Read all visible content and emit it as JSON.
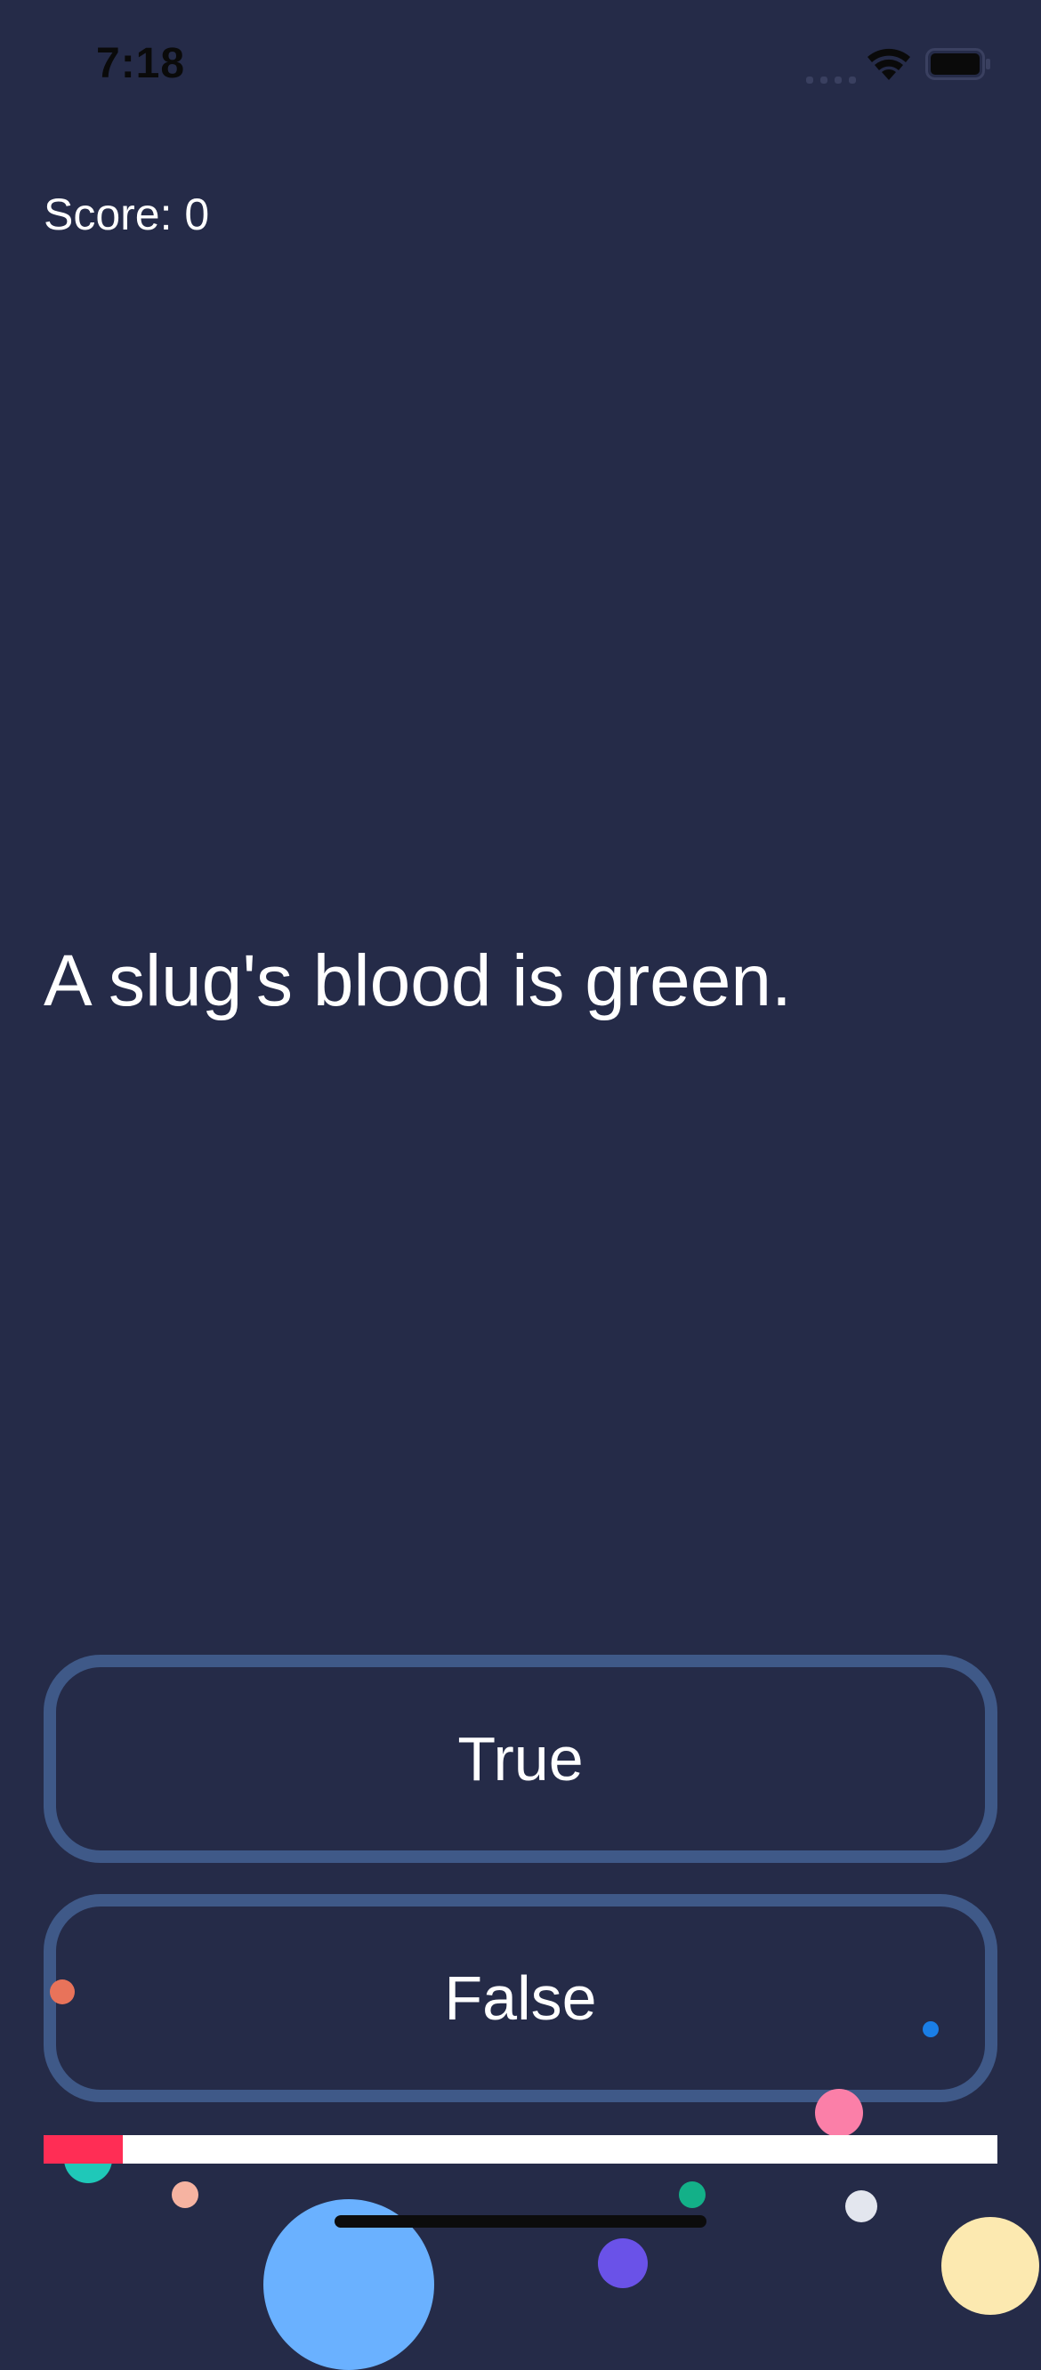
{
  "status_bar": {
    "time": "7:18"
  },
  "score": {
    "label": "Score: 0"
  },
  "question": {
    "text": "A slug's blood is green."
  },
  "answers": {
    "true_label": "True",
    "false_label": "False"
  },
  "progress": {
    "value": 0.083,
    "fill_color": "#ff2d55",
    "track_color": "#ffffff"
  },
  "theme": {
    "background": "#252b48",
    "button_border": "#3f5988"
  }
}
